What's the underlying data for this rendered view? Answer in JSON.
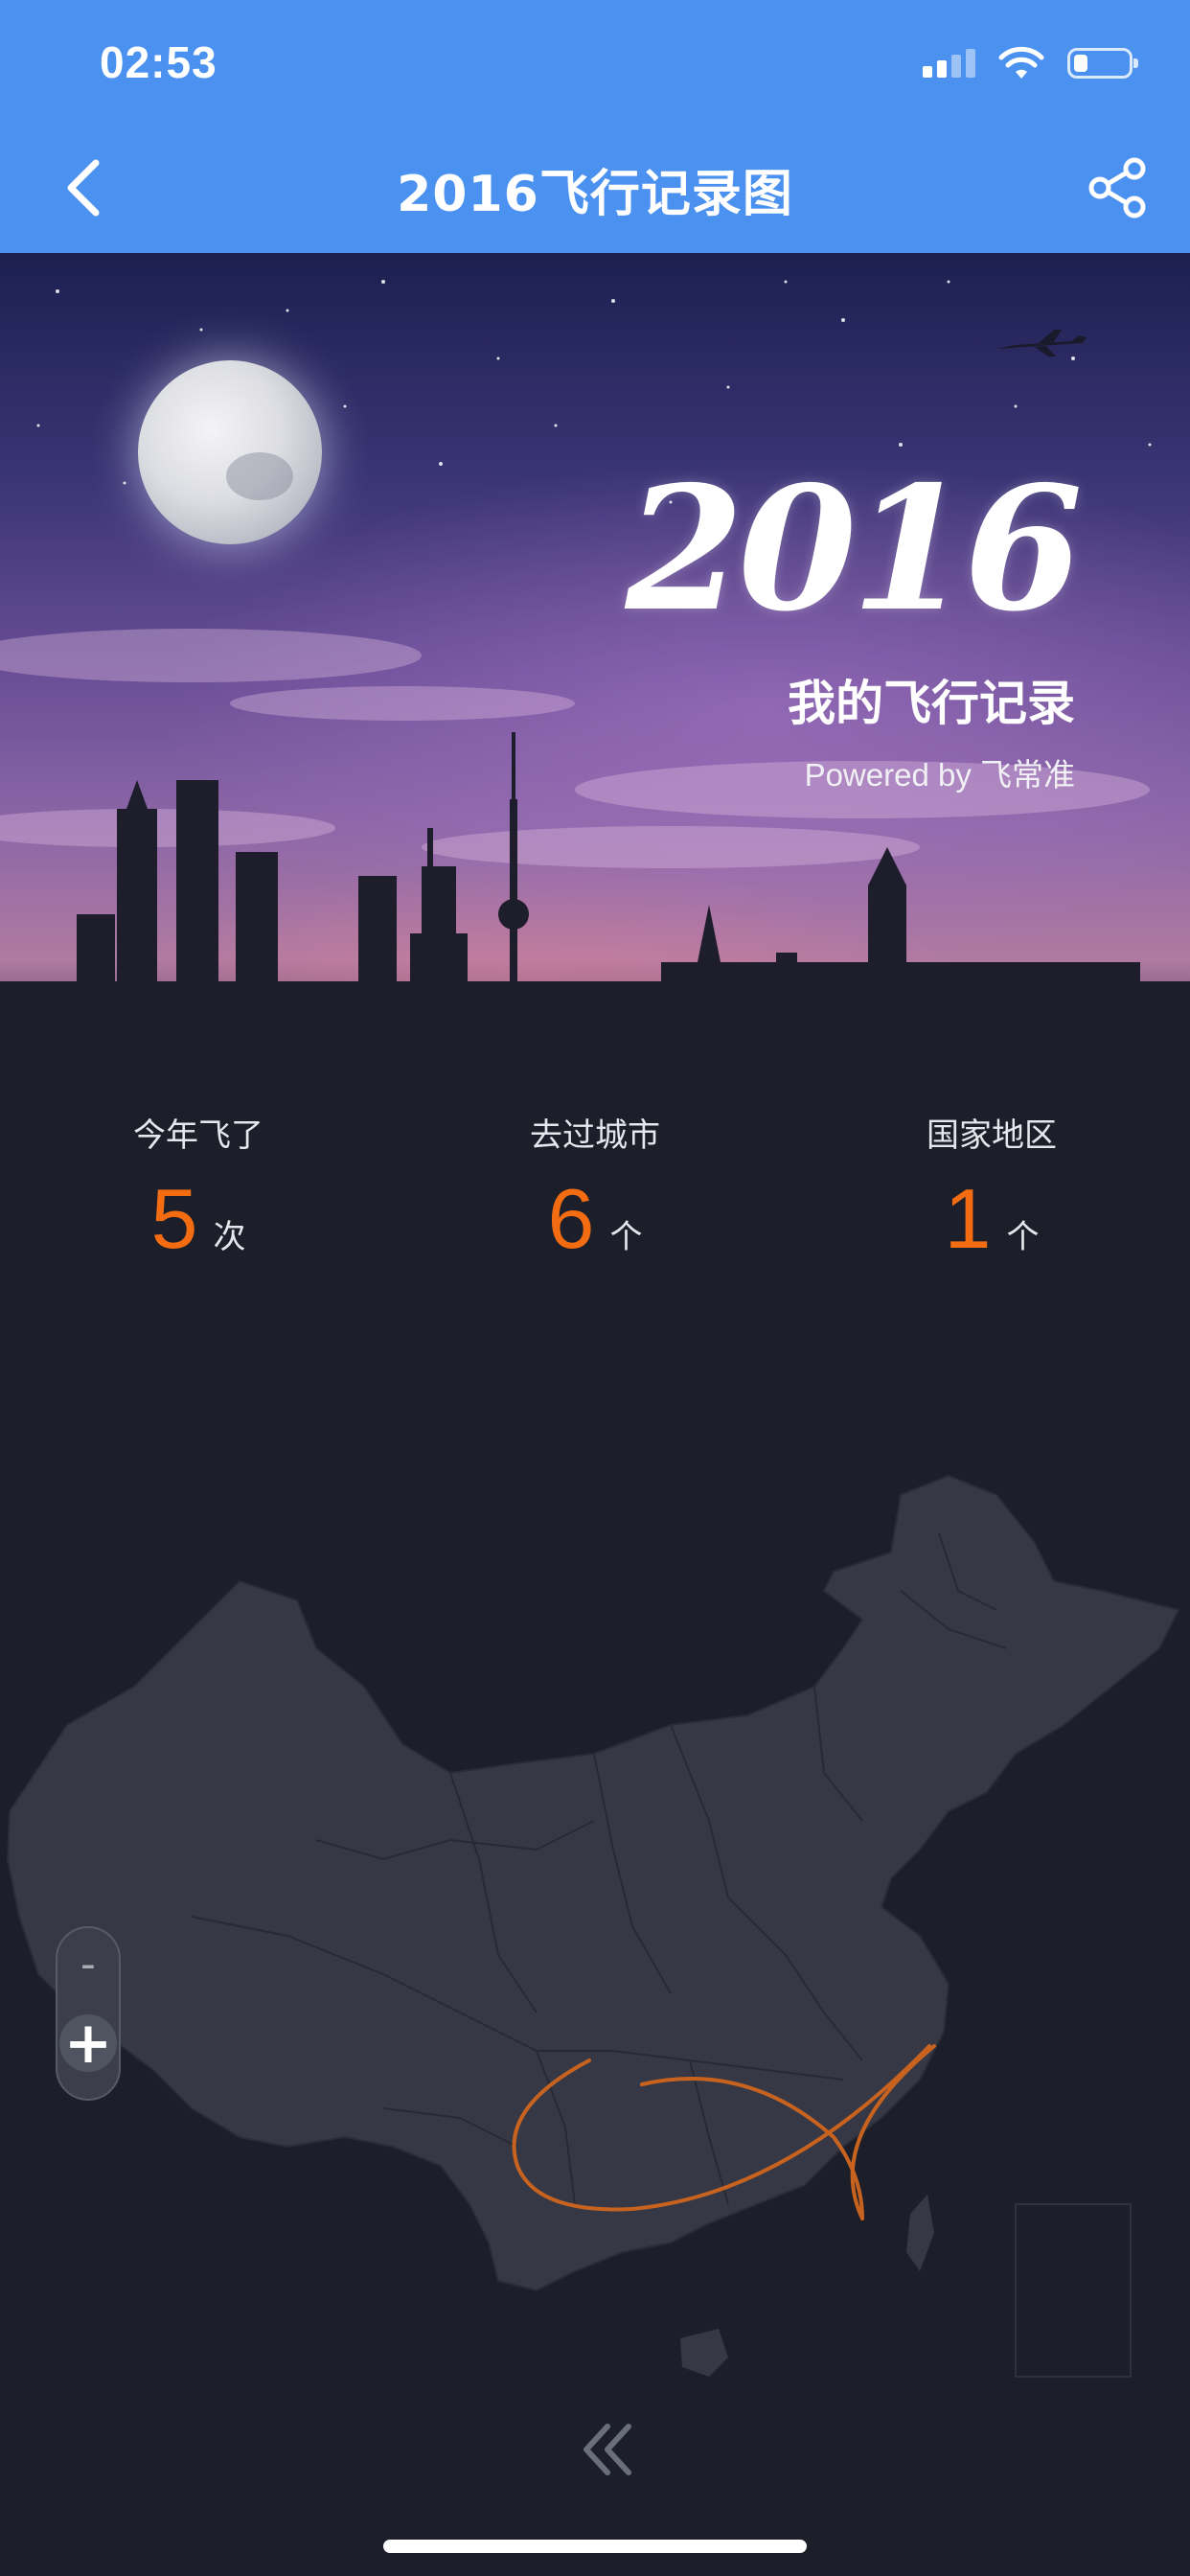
{
  "status_bar": {
    "time": "02:53",
    "icons": [
      "cellular-signal-icon",
      "wifi-icon",
      "battery-icon"
    ],
    "battery_level": 0.2
  },
  "nav": {
    "title": "2016飞行记录图",
    "back_icon": "chevron-left-icon",
    "share_icon": "share-icon"
  },
  "banner": {
    "year": "2016",
    "subtitle": "我的飞行记录",
    "powered_by": "Powered by 飞常准"
  },
  "stats": [
    {
      "label": "今年飞了",
      "value": "5",
      "unit": "次"
    },
    {
      "label": "去过城市",
      "value": "6",
      "unit": "个"
    },
    {
      "label": "国家地区",
      "value": "1",
      "unit": "个"
    }
  ],
  "map": {
    "zoom_out_label": "-",
    "zoom_in_label": "+",
    "route_color": "#c8621f",
    "land_color": "#363945"
  },
  "footer": {
    "collapse_icon": "double-chevron-left-icon"
  },
  "colors": {
    "header_bg": "#4b91ef",
    "page_bg": "#1c1f2a",
    "accent": "#f36c12"
  }
}
